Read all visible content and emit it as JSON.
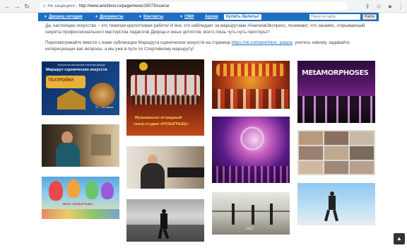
{
  "browser": {
    "security_label": "Не защищено",
    "url": "http://www.anichkov.ru/page/news/15073/ccena/"
  },
  "nav": {
    "items": [
      {
        "label": "Дворец сегодня"
      },
      {
        "label": "Документы"
      },
      {
        "label": "Контакты"
      },
      {
        "label": "СМИ"
      },
      {
        "label": "Архив"
      }
    ],
    "buy_button": "Купить билеты!",
    "search_placeholder": "Поиск по сайту",
    "search_button": "Найти"
  },
  "content": {
    "para1": "Да, настоящее искусство – это тяжелая кропотливая работа! И все, кто наблюдает за маршрутами #АничковЭкспресс, понимают, что занавес, открывающий секреты профессионального мастерства педагогов Дворца и юных артистов, всего лишь чуть-чуть приоткрыт!",
    "para2_before": "Пересматривайте вместе с нами публикации Маршрута сценических искусств на странице ",
    "para2_link": "https://vk.com/anichkov_palace",
    "para2_after": ", учитесь новому, задавайте интересующие вас вопросы, а мы уже в пути по Спортивному маршруту!"
  },
  "gallery": {
    "poster_top": "Творческая мастерская Аничкова Дворца",
    "poster_title": "Маршрут сценических искусств",
    "poster_dates": "07 – 12 июня",
    "poster_brand": "ТЕАТРОЙКИ",
    "theatre_line1": "Музыкально-эстрадный",
    "theatre_line2": "театр-студия «РОЗЫГРЫШ»",
    "metamorphoses": "MEtAMORPHOSES",
    "mteс_label": "МЭТС «РОЗЫГРЫШ»",
    "year_label": "2015",
    "colors": {
      "nav_bg": "#1e6ec3",
      "link": "#1e6ec3"
    }
  }
}
